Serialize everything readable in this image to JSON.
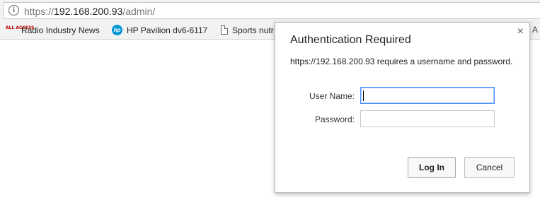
{
  "address_bar": {
    "icon": "info-icon",
    "url_scheme": "https://",
    "url_host": "192.168.200.93",
    "url_path": "/admin/"
  },
  "bookmarks": [
    {
      "label": "Radio Industry News",
      "icon": "radio-logo-icon",
      "icon_text": "ALL ACCESS"
    },
    {
      "label": "HP Pavilion dv6-6117",
      "icon": "hp-logo-icon",
      "icon_text": "hp"
    },
    {
      "label": "Sports nutr",
      "icon": "document-icon"
    }
  ],
  "bookmarks_overflow": "A",
  "dialog": {
    "title": "Authentication Required",
    "message": "https://192.168.200.93 requires a username and password.",
    "close_glyph": "×",
    "username_label": "User Name:",
    "username_value": "",
    "password_label": "Password:",
    "password_value": "",
    "login_label": "Log In",
    "cancel_label": "Cancel"
  },
  "colors": {
    "focus_ring": "#4d90fe",
    "hp_blue": "#0096d6",
    "toolbar_bg": "#f2f2f2"
  }
}
